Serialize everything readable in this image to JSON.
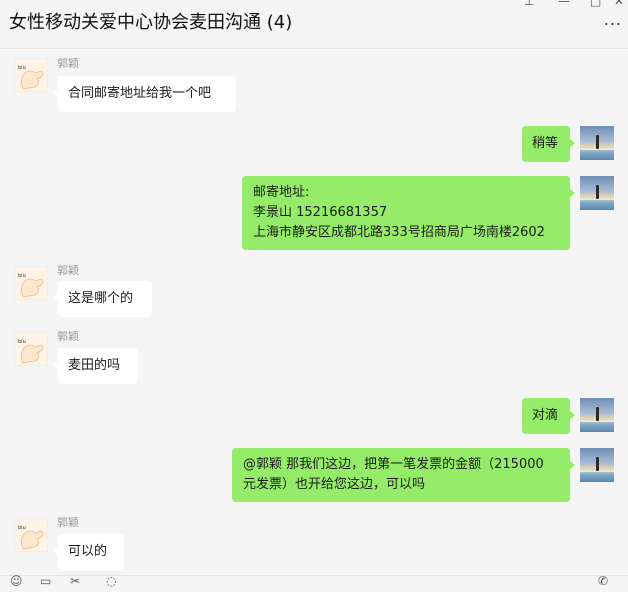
{
  "window": {
    "title": "女性移动关爱中心协会麦田沟通 (4)",
    "controls": {
      "pin": "⊥",
      "minimize": "—",
      "maximize": "□",
      "close": "✕"
    },
    "more": "..."
  },
  "messages": [
    {
      "side": "left",
      "sender": "郭颖",
      "text": "合同邮寄地址给我一个吧"
    },
    {
      "side": "right",
      "text": "稍等"
    },
    {
      "side": "right",
      "lines": [
        "邮寄地址:",
        "李景山  15216681357",
        "上海市静安区成都北路333号招商局广场南楼2602"
      ]
    },
    {
      "side": "left",
      "sender": "郭颖",
      "text": "这是哪个的"
    },
    {
      "side": "left",
      "sender": "郭颖",
      "text": "麦田的吗"
    },
    {
      "side": "right",
      "text": "对滴"
    },
    {
      "side": "right",
      "lines": [
        "@郭颖 那我们这边，把第一笔发票的金额（215000",
        "元发票）也开给您这边，可以吗"
      ]
    },
    {
      "side": "left",
      "sender": "郭颖",
      "text": "可以的"
    }
  ],
  "toolbar": {
    "icons": [
      "emoji-icon",
      "folder-icon",
      "scissors-icon",
      "chat-history-icon",
      "voice-call-icon"
    ]
  }
}
